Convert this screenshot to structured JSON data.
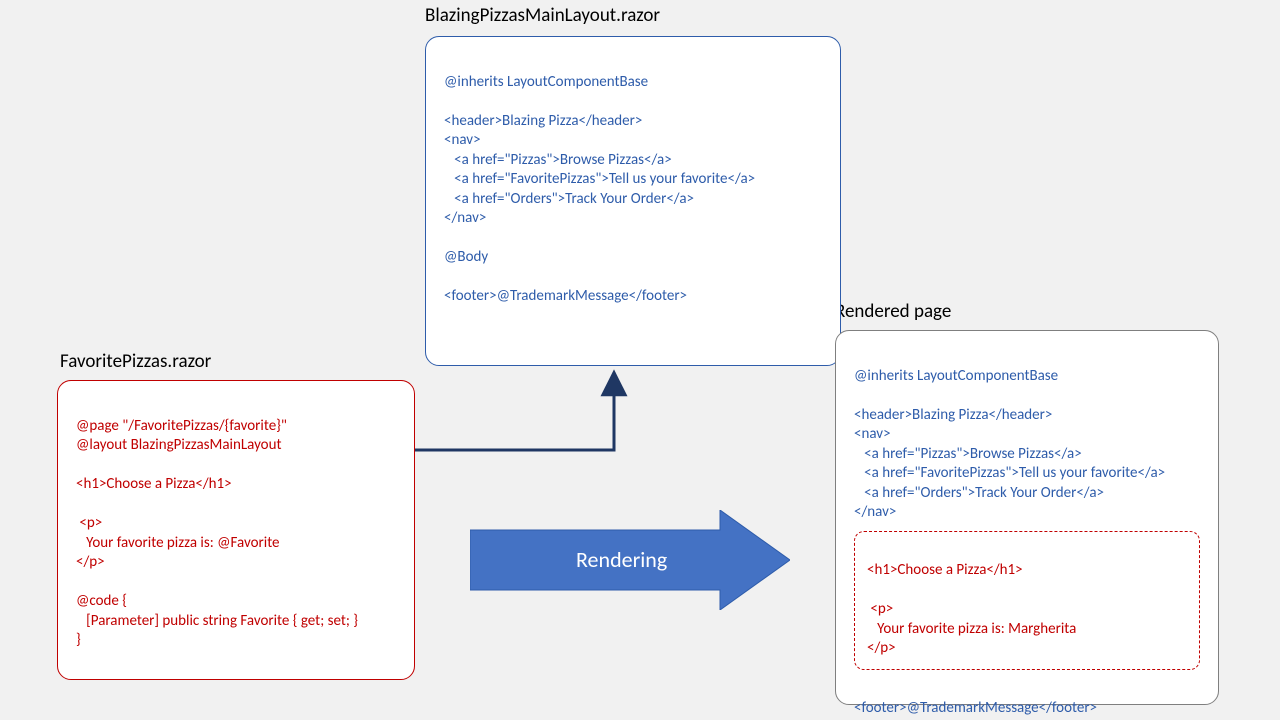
{
  "titles": {
    "layout": "BlazingPizzasMainLayout.razor",
    "favorite": "FavoritePizzas.razor",
    "rendered": "Rendered page"
  },
  "layout_box": {
    "l1": "@inherits LayoutComponentBase",
    "l2": "",
    "l3": "<header>Blazing Pizza</header>",
    "l4": "<nav>",
    "l5": "   <a href=\"Pizzas\">Browse Pizzas</a>",
    "l6": "   <a href=\"FavoritePizzas\">Tell us your favorite</a>",
    "l7": "   <a href=\"Orders\">Track Your Order</a>",
    "l8": "</nav>",
    "l9": "",
    "l10": "@Body",
    "l11": "",
    "l12": "<footer>@TrademarkMessage</footer>"
  },
  "favorite_box": {
    "l1": "@page \"/FavoritePizzas/{favorite}\"",
    "l2": "@layout BlazingPizzasMainLayout",
    "l3": "",
    "l4": "<h1>Choose a Pizza</h1>",
    "l5": "",
    "l6": " <p>",
    "l7": "   Your favorite pizza is: @Favorite",
    "l8": "</p>",
    "l9": "",
    "l10": "@code {",
    "l11": "   [Parameter] public string Favorite { get; set; }",
    "l12": "}"
  },
  "rendered_box": {
    "top": {
      "l1": "@inherits LayoutComponentBase",
      "l2": "",
      "l3": "<header>Blazing Pizza</header>",
      "l4": "<nav>",
      "l5": "   <a href=\"Pizzas\">Browse Pizzas</a>",
      "l6": "   <a href=\"FavoritePizzas\">Tell us your favorite</a>",
      "l7": "   <a href=\"Orders\">Track Your Order</a>",
      "l8": "</nav>"
    },
    "body": {
      "l1": "<h1>Choose a Pizza</h1>",
      "l2": "",
      "l3": " <p>",
      "l4": "   Your favorite pizza is: Margherita",
      "l5": "</p>"
    },
    "bottom": {
      "l1": "<footer>@TrademarkMessage</footer>"
    }
  },
  "arrow_label": "Rendering"
}
